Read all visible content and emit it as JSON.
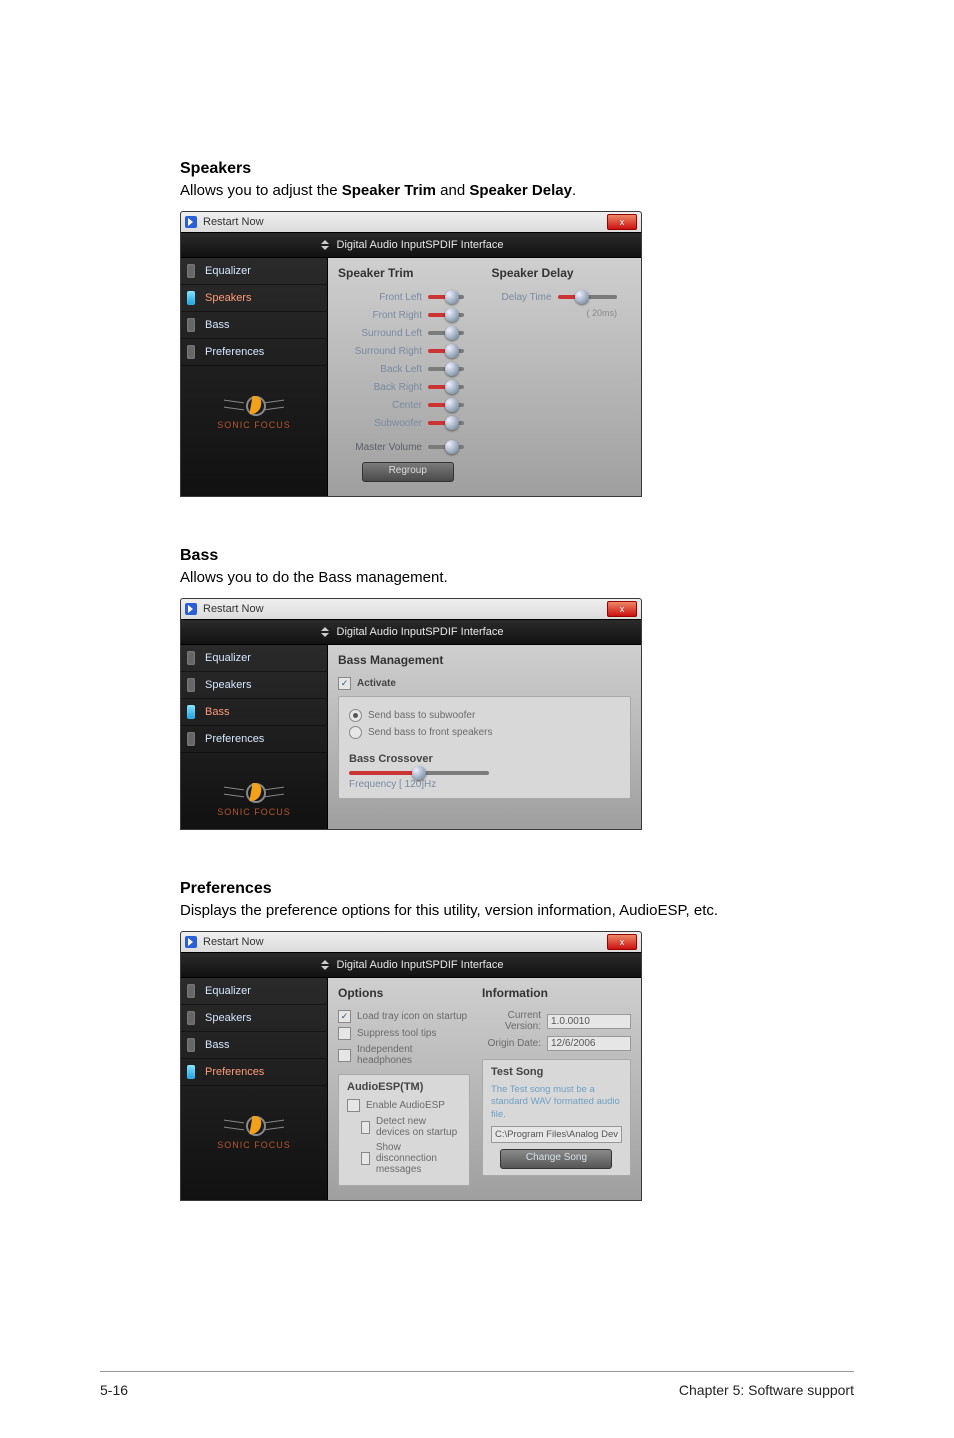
{
  "page": {
    "left": "5-16",
    "right": "Chapter 5: Software support"
  },
  "sections": {
    "speakers": {
      "title": "Speakers",
      "desc_pre": "Allows you to adjust the ",
      "desc_b1": "Speaker Trim",
      "desc_mid": " and ",
      "desc_b2": "Speaker Delay",
      "desc_post": "."
    },
    "bass": {
      "title": "Bass",
      "desc": "Allows you to do the Bass management."
    },
    "prefs": {
      "title": "Preferences",
      "desc": "Displays the preference options for this utility, version information, AudioESP, etc."
    }
  },
  "shell": {
    "title": "Restart Now",
    "device": "Digital Audio InputSPDIF Interface",
    "brand": "SONIC FOCUS",
    "close_x": "x"
  },
  "nav": {
    "equalizer": "Equalizer",
    "speakers": "Speakers",
    "bass": "Bass",
    "preferences": "Preferences"
  },
  "speakers_panel": {
    "trim_h": "Speaker Trim",
    "delay_h": "Speaker Delay",
    "channels": {
      "fl": "Front Left",
      "fr": "Front Right",
      "sl": "Surround Left",
      "sr": "Surround Right",
      "bl": "Back Left",
      "br": "Back Right",
      "c": "Center",
      "sw": "Subwoofer"
    },
    "master": "Master Volume",
    "delay_label": "Delay Time",
    "delay_note": "( 20ms)",
    "regroup": "Regroup"
  },
  "bass_panel": {
    "title": "Bass Management",
    "activate": "Activate",
    "opt_sub": "Send bass to subwoofer",
    "opt_front": "Send bass to front speakers",
    "crossover": "Bass Crossover",
    "freq": "Frequency   [ 120]Hz"
  },
  "prefs_panel": {
    "options_h": "Options",
    "info_h": "Information",
    "opt_tray": "Load tray icon on startup",
    "opt_tips": "Suppress tool tips",
    "opt_hp": "Independent headphones",
    "esp_h": "AudioESP(TM)",
    "esp_enable": "Enable AudioESP",
    "esp_detect": "Detect new devices on startup",
    "esp_disc": "Show disconnection messages",
    "ver_k": "Current Version:",
    "ver_v": "1.0.0010",
    "date_k": "Origin Date:",
    "date_v": "12/6/2006",
    "test_h": "Test Song",
    "test_desc": "The Test song must be a standard WAV formatted audio file.",
    "test_path": "C:\\Program Files\\Analog Dev",
    "change": "Change Song"
  }
}
